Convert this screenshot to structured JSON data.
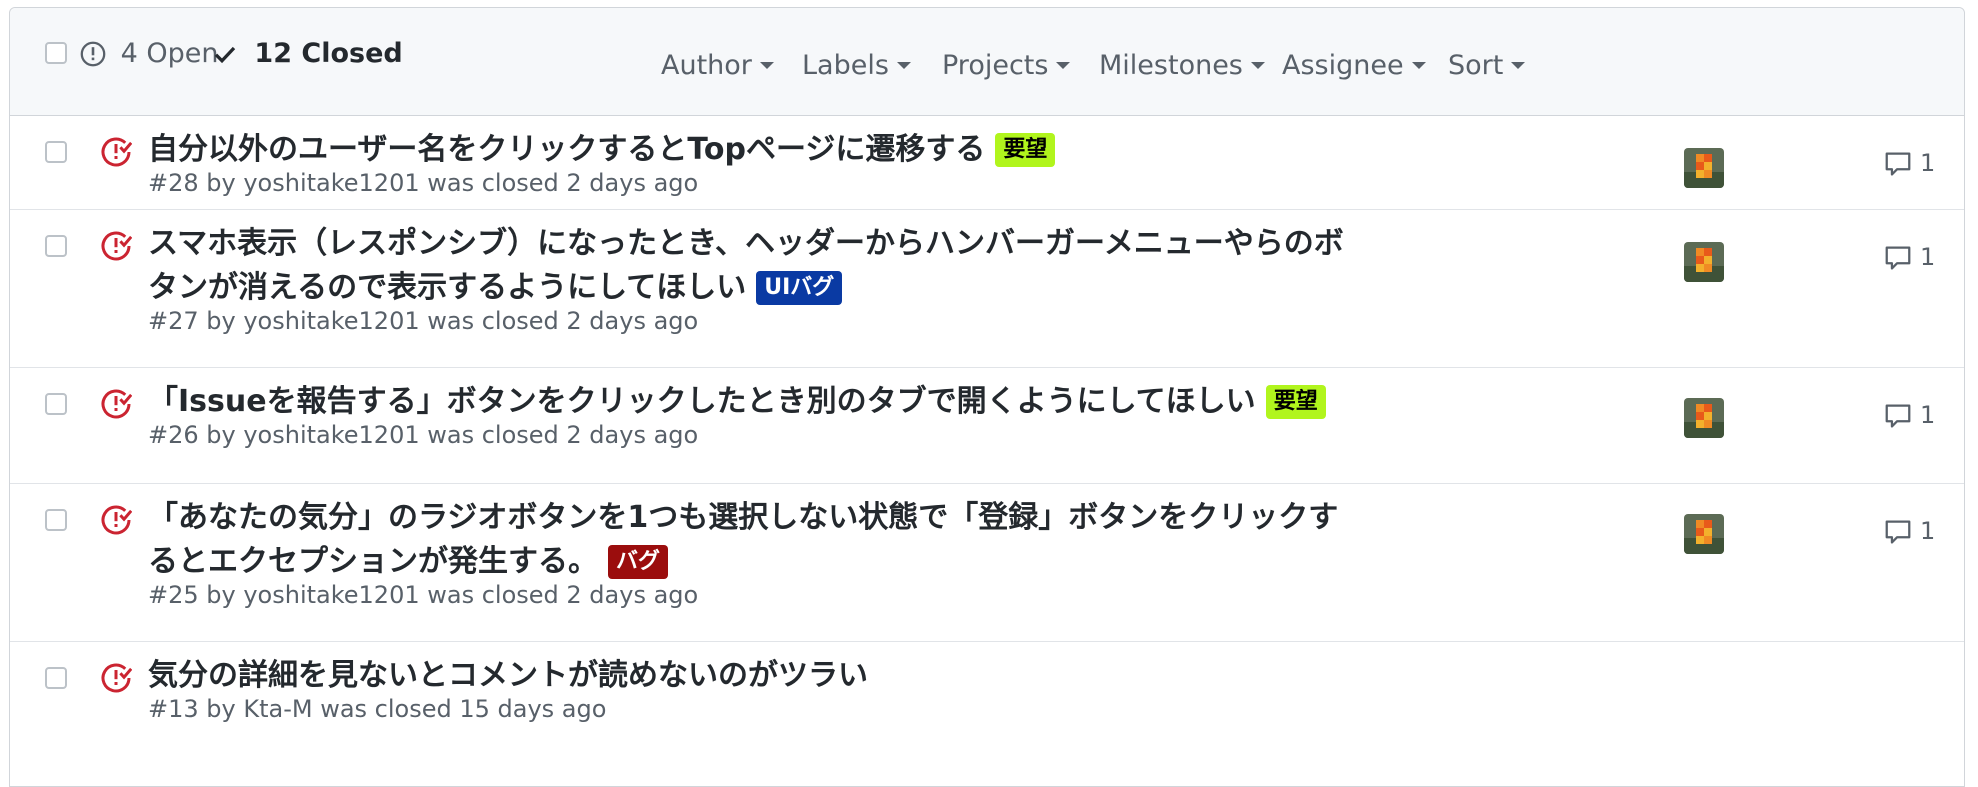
{
  "header": {
    "open_count_label": "4 Open",
    "closed_count_label": "12 Closed",
    "filters": [
      "Author",
      "Labels",
      "Projects",
      "Milestones",
      "Assignee",
      "Sort"
    ]
  },
  "issues": [
    {
      "title_lines": [
        "自分以外のユーザー名をクリックするとTopページに遷移する"
      ],
      "label": {
        "text": "要望",
        "bg": "#b1f51d",
        "fg": "#000000"
      },
      "meta": "#28 by yoshitake1201 was closed 2 days ago",
      "comment_count": "1",
      "has_avatar": true
    },
    {
      "title_lines": [
        "スマホ表示（レスポンシブ）になったとき、ヘッダーからハンバーガーメニューやらのボ",
        "タンが消えるので表示するようにしてほしい"
      ],
      "label": {
        "text": "UIバグ",
        "bg": "#0a3aa3",
        "fg": "#ffffff"
      },
      "meta": "#27 by yoshitake1201 was closed 2 days ago",
      "comment_count": "1",
      "has_avatar": true
    },
    {
      "title_lines": [
        "「Issueを報告する」ボタンをクリックしたとき別のタブで開くようにしてほしい"
      ],
      "label": {
        "text": "要望",
        "bg": "#b1f51d",
        "fg": "#000000"
      },
      "meta": "#26 by yoshitake1201 was closed 2 days ago",
      "comment_count": "1",
      "has_avatar": true
    },
    {
      "title_lines": [
        "「あなたの気分」のラジオボタンを1つも選択しない状態で「登録」ボタンをクリックす",
        "るとエクセプションが発生する。"
      ],
      "label": {
        "text": "バグ",
        "bg": "#9b0d0d",
        "fg": "#ffffff"
      },
      "meta": "#25 by yoshitake1201 was closed 2 days ago",
      "comment_count": "1",
      "has_avatar": true
    },
    {
      "title_lines": [
        "気分の詳細を見ないとコメントが読めないのがツラい"
      ],
      "label": null,
      "meta": "#13 by Kta-M was closed 15 days ago",
      "comment_count": "",
      "has_avatar": false
    }
  ],
  "colors": {
    "closed_issue_icon": "#cb2431",
    "muted_text": "#586069",
    "header_bg": "#f6f8fa"
  }
}
